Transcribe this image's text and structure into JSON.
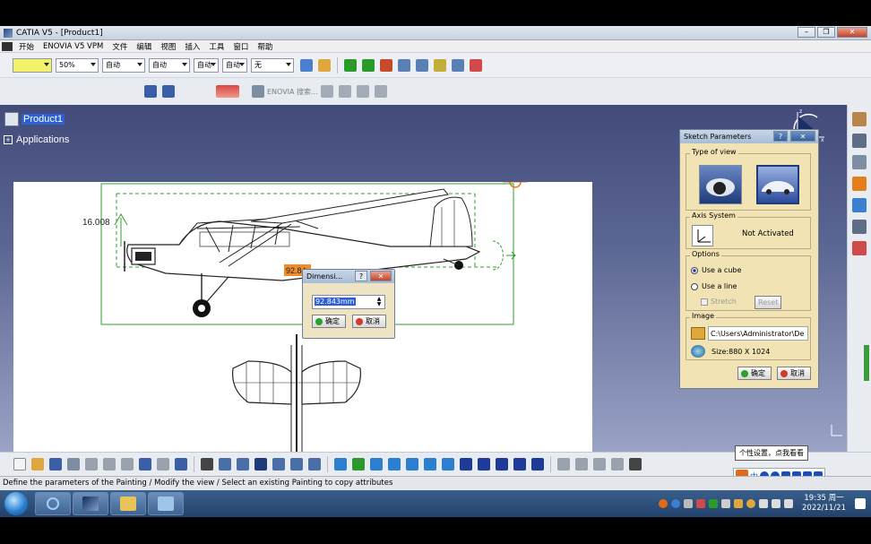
{
  "window": {
    "title": "CATIA V5 - [Product1]"
  },
  "menu": {
    "items": [
      "开始",
      "ENOVIA V5 VPM",
      "文件",
      "编辑",
      "视图",
      "插入",
      "工具",
      "窗口",
      "帮助"
    ]
  },
  "toolbar1": {
    "color_combo": "",
    "transparency_combo": "50%",
    "thickness_combo": "自动",
    "linetype_combo": "自动",
    "point_combo": "自动",
    "layer_combo": "自动",
    "layer2_combo": "无"
  },
  "toolbar2": {
    "enovia_label": "ENOVIA 搜索..."
  },
  "tree": {
    "root_label": "Product1",
    "child_label": "Applications"
  },
  "drawing": {
    "dimension_value": "16.008",
    "orange_dim": "92.84"
  },
  "dimension_dialog": {
    "title": "Dimensi...",
    "value": "92.843mm",
    "ok_label": "确定",
    "cancel_label": "取消"
  },
  "sketch_dialog": {
    "title": "Sketch Parameters",
    "type_of_view": "Type of view",
    "axis_system": "Axis System",
    "axis_status": "Not Activated",
    "options": "Options",
    "use_cube": "Use a cube",
    "use_line": "Use a line",
    "stretch": "Stretch",
    "reset": "Reset",
    "image": "Image",
    "image_path": "C:\\Users\\Administrator\\De",
    "image_size": "Size:880 X 1024",
    "ok_label": "确定",
    "cancel_label": "取消"
  },
  "status": {
    "text": "Define the parameters of the Painting / Modify the view / Select an existing Painting to copy attributes"
  },
  "ime": {
    "tooltip": "个性设置，点我看看",
    "label": "中"
  },
  "taskbar": {
    "time": "19:35 周一",
    "date": "2022/11/21"
  },
  "colors": {
    "selection_blue": "#2d5fd4",
    "dialog_bg": "#f1e3b3",
    "green_frame": "#2fa12f"
  }
}
